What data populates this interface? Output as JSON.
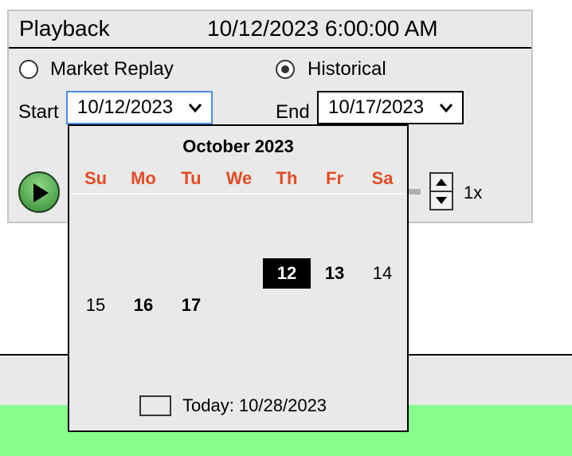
{
  "panel": {
    "title": "Playback",
    "datetime": "10/12/2023 6:00:00 AM",
    "mode_options": [
      {
        "label": "Market Replay",
        "selected": false
      },
      {
        "label": "Historical",
        "selected": true
      }
    ],
    "start_label": "Start",
    "start_value": "10/12/2023",
    "end_label": "End",
    "end_value": "10/17/2023",
    "speed": "1x",
    "play_icon": "play-icon"
  },
  "calendar": {
    "title": "October 2023",
    "weekdays": [
      "Su",
      "Mo",
      "Tu",
      "We",
      "Th",
      "Fr",
      "Sa"
    ],
    "days": {
      "d12": "12",
      "d13": "13",
      "d14": "14",
      "d15": "15",
      "d16": "16",
      "d17": "17"
    },
    "today_label": "Today: 10/28/2023"
  },
  "colors": {
    "weekday_header": "#e34b25",
    "panel_bg": "#e8e9e8",
    "selected_day_bg": "#000000",
    "footer_green": "#87ff8e",
    "focus_border": "#4a8fe0"
  }
}
